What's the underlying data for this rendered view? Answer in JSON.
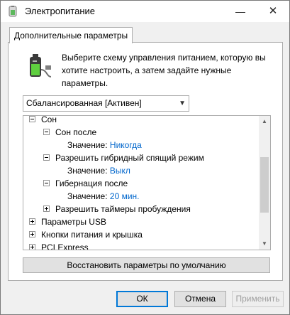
{
  "window": {
    "title": "Электропитание",
    "minimize": "—",
    "close": "✕"
  },
  "tab": {
    "label": "Дополнительные параметры"
  },
  "description": "Выберите схему управления питанием, которую вы хотите настроить, а затем задайте нужные параметры.",
  "plan_select": {
    "value": "Сбалансированная [Активен]"
  },
  "tree": {
    "rows": [
      {
        "label": "Сон",
        "expander": "minus"
      },
      {
        "label": "Сон после",
        "expander": "minus"
      },
      {
        "label": "Значение:",
        "value": "Никогда"
      },
      {
        "label": "Разрешить гибридный спящий режим",
        "expander": "minus"
      },
      {
        "label": "Значение:",
        "value": "Выкл"
      },
      {
        "label": "Гибернация после",
        "expander": "minus"
      },
      {
        "label": "Значение:",
        "value": "20 мин."
      },
      {
        "label": "Разрешить таймеры пробуждения",
        "expander": "plus"
      },
      {
        "label": "Параметры USB",
        "expander": "plus"
      },
      {
        "label": "Кнопки питания и крышка",
        "expander": "plus"
      },
      {
        "label": "PCI Express",
        "expander": "plus"
      }
    ]
  },
  "restore_button": "Восстановить параметры по умолчанию",
  "buttons": {
    "ok": "ОК",
    "cancel": "Отмена",
    "apply": "Применить"
  },
  "colors": {
    "accent": "#0078d7",
    "value_text": "#0066cc"
  }
}
